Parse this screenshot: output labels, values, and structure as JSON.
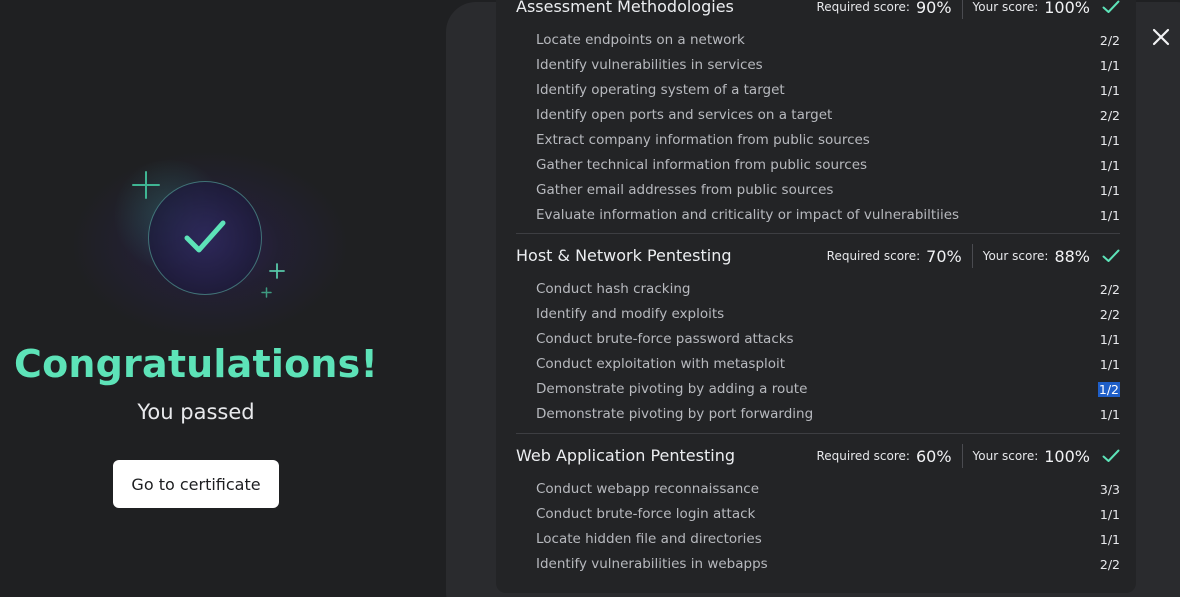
{
  "hero": {
    "title": "Congratulations!",
    "subtitle": "You passed",
    "button_label": "Go to certificate",
    "accent_color": "#5de3b8"
  },
  "sections": [
    {
      "title": "Assessment Methodologies",
      "required_label": "Required score:",
      "required_value": "90%",
      "your_label": "Your score:",
      "your_value": "100%",
      "items": [
        {
          "label": "Locate endpoints on a network",
          "score": "2/2"
        },
        {
          "label": "Identify vulnerabilities in services",
          "score": "1/1"
        },
        {
          "label": "Identify operating system of a target",
          "score": "1/1"
        },
        {
          "label": "Identify open ports and services on a target",
          "score": "2/2"
        },
        {
          "label": "Extract company information from public sources",
          "score": "1/1"
        },
        {
          "label": "Gather technical information from public sources",
          "score": "1/1"
        },
        {
          "label": "Gather email addresses from public sources",
          "score": "1/1"
        },
        {
          "label": "Evaluate information and criticality or impact of vulnerabiltiies",
          "score": "1/1"
        }
      ]
    },
    {
      "title": "Host & Network Pentesting",
      "required_label": "Required score:",
      "required_value": "70%",
      "your_label": "Your score:",
      "your_value": "88%",
      "items": [
        {
          "label": "Conduct hash cracking",
          "score": "2/2"
        },
        {
          "label": "Identify and modify exploits",
          "score": "2/2"
        },
        {
          "label": "Conduct brute-force password attacks",
          "score": "1/1"
        },
        {
          "label": "Conduct exploitation with metasploit",
          "score": "1/1"
        },
        {
          "label": "Demonstrate pivoting by adding a route",
          "score": "1/2"
        },
        {
          "label": "Demonstrate pivoting by port forwarding",
          "score": "1/1"
        }
      ]
    },
    {
      "title": "Web Application Pentesting",
      "required_label": "Required score:",
      "required_value": "60%",
      "your_label": "Your score:",
      "your_value": "100%",
      "items": [
        {
          "label": "Conduct webapp reconnaissance",
          "score": "3/3"
        },
        {
          "label": "Conduct brute-force login attack",
          "score": "1/1"
        },
        {
          "label": "Locate hidden file and directories",
          "score": "1/1"
        },
        {
          "label": "Identify vulnerabilities in webapps",
          "score": "2/2"
        }
      ]
    }
  ],
  "icons": {
    "close": "close-icon",
    "check": "check-icon",
    "sparkle": "plus-sparkle-icon"
  }
}
